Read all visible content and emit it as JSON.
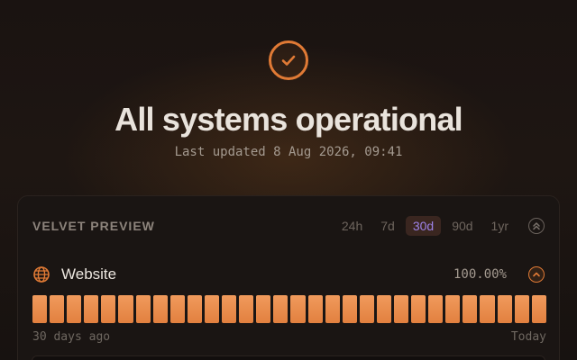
{
  "hero": {
    "title": "All systems operational",
    "updated": "Last updated 8 Aug 2026, 09:41",
    "icon": "check-circle-icon"
  },
  "colors": {
    "accent": "#e07a35",
    "active_range": "#9d82e6",
    "bar_operational": "#ec8a4a"
  },
  "card": {
    "title": "VELVET PREVIEW",
    "ranges": [
      {
        "label": "24h",
        "active": false
      },
      {
        "label": "7d",
        "active": false
      },
      {
        "label": "30d",
        "active": true
      },
      {
        "label": "90d",
        "active": false
      },
      {
        "label": "1yr",
        "active": false
      }
    ],
    "collapse_icon": "chevrons-up-icon",
    "service": {
      "icon": "globe-icon",
      "name": "Website",
      "uptime": "100.00%",
      "expand_icon": "chevron-up-icon",
      "days": 30,
      "status": "operational",
      "label_start": "30 days ago",
      "label_end": "Today"
    }
  }
}
